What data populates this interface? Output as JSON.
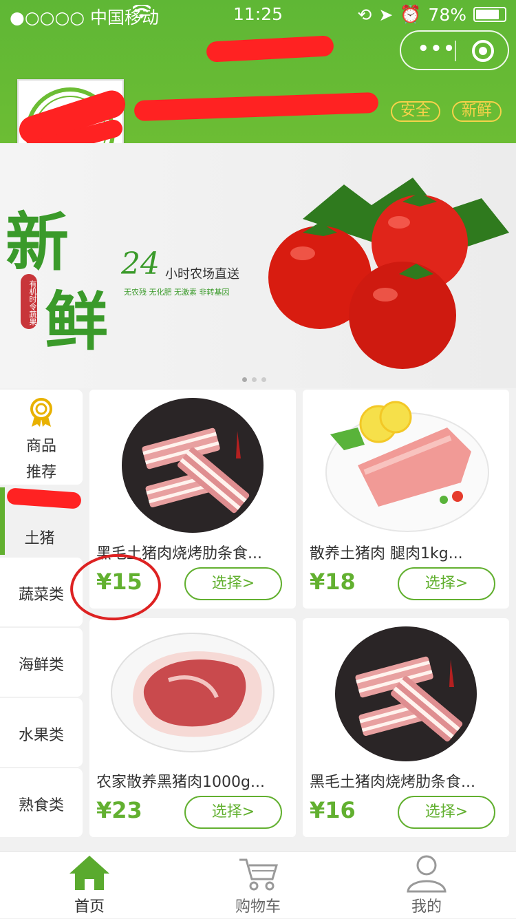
{
  "status": {
    "carrier": "●○○○○ 中国移动",
    "time": "11:25",
    "battery": "78%"
  },
  "header": {
    "capsule_more": "•••"
  },
  "tags": [
    "安全",
    "新鲜"
  ],
  "banner": {
    "big1": "新",
    "big2": "鲜",
    "seal": "有机时令蔬果",
    "hours": "24",
    "headline": "小时农场直送",
    "sub": "无农残 无化肥 无激素 非转基因"
  },
  "sidebar": {
    "items": [
      {
        "label1": "商品",
        "label2": "推荐"
      },
      {
        "label1": "",
        "label2": "土猪"
      },
      {
        "label1": "蔬菜类"
      },
      {
        "label1": "海鲜类"
      },
      {
        "label1": "水果类"
      },
      {
        "label1": "熟食类"
      }
    ]
  },
  "products": [
    {
      "name": "黑毛土猪肉烧烤肋条食...",
      "price": "¥15",
      "button": "选择>"
    },
    {
      "name": "散养土猪肉 腿肉1kg...",
      "price": "¥18",
      "button": "选择>"
    },
    {
      "name": "农家散养黑猪肉1000g...",
      "price": "¥23",
      "button": "选择>"
    },
    {
      "name": "黑毛土猪肉烧烤肋条食...",
      "price": "¥16",
      "button": "选择>"
    }
  ],
  "tabbar": [
    {
      "label": "首页"
    },
    {
      "label": "购物车"
    },
    {
      "label": "我的"
    }
  ],
  "colors": {
    "accent": "#62b030",
    "header": "#66ba34",
    "tag": "#f6d24a",
    "annotation": "#d22"
  }
}
